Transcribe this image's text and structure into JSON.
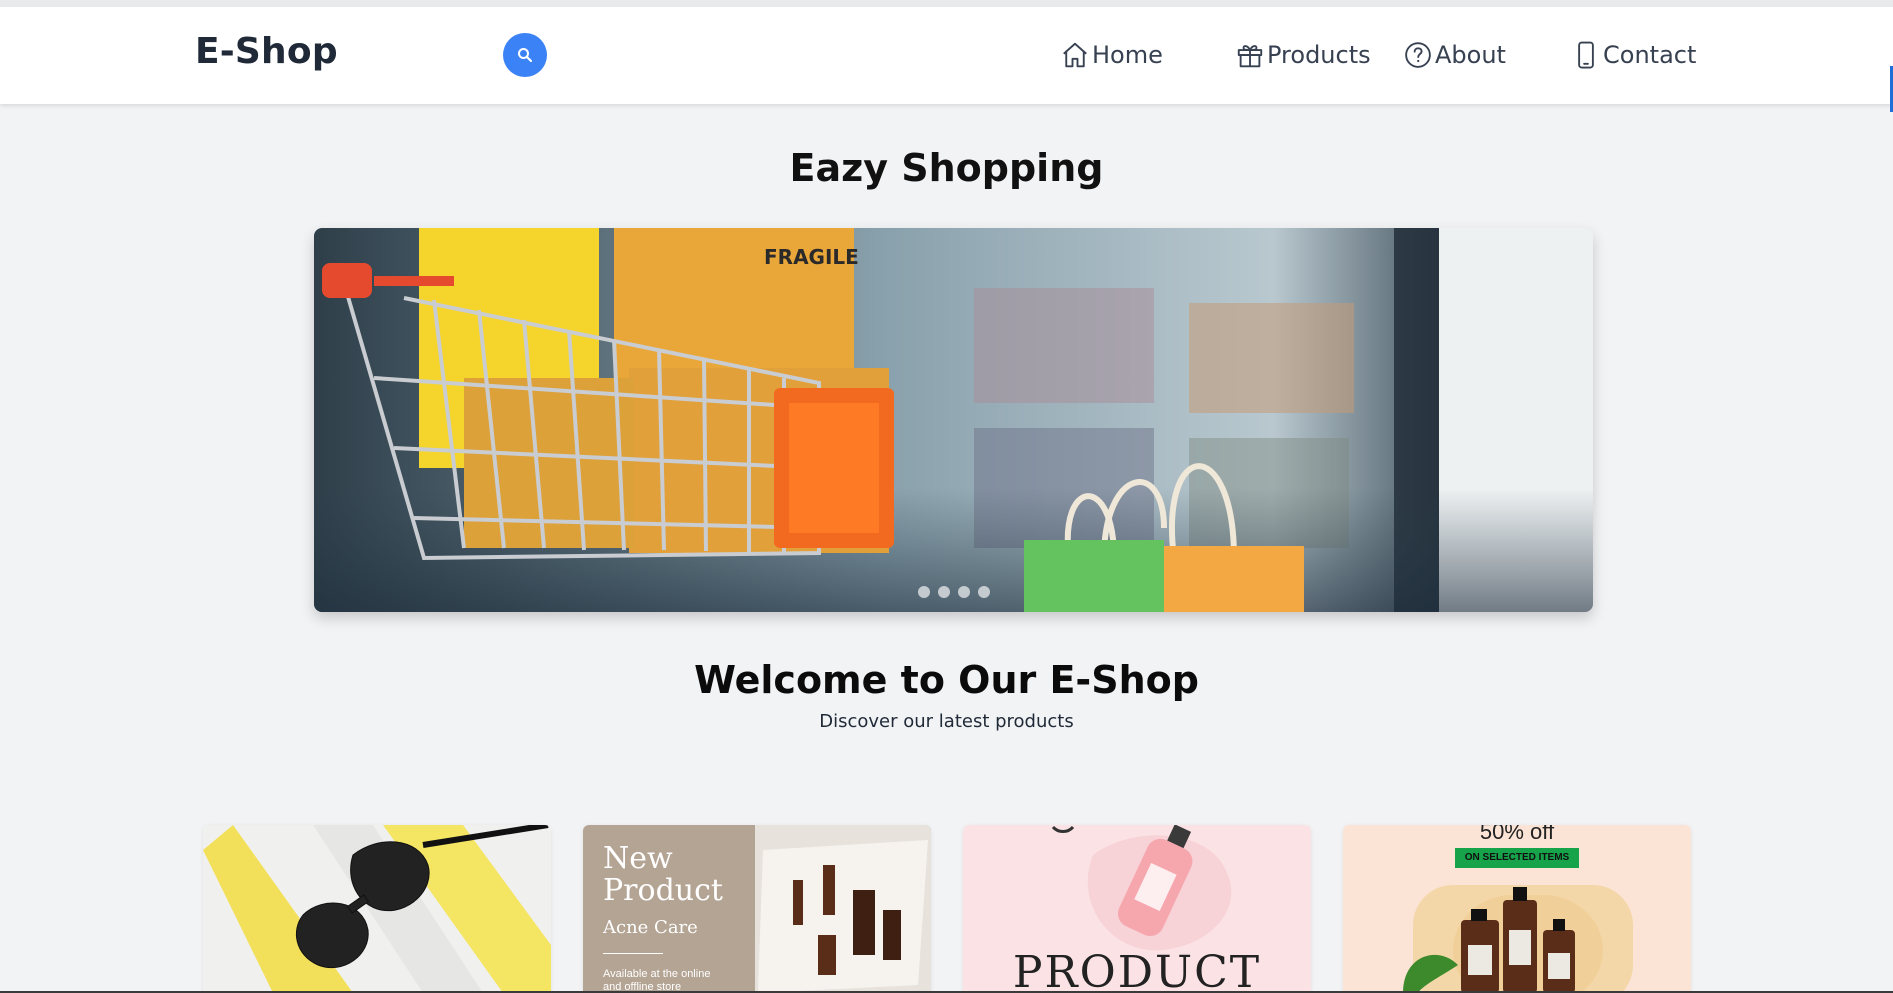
{
  "navbar": {
    "brand": "E-Shop",
    "search_icon": "search-icon",
    "items": [
      {
        "label": "Home",
        "icon": "home-icon"
      },
      {
        "label": "Products",
        "icon": "gift-icon"
      },
      {
        "label": "About",
        "icon": "question-circle-icon"
      },
      {
        "label": "Contact",
        "icon": "phone-icon"
      }
    ]
  },
  "hero": {
    "title": "Eazy Shopping",
    "slide_box_label": "FRAGILE",
    "slide_count": 4,
    "active_slide": 1
  },
  "welcome": {
    "title": "Welcome to Our E-Shop",
    "subtitle": "Discover our latest products"
  },
  "products": [
    {
      "image": "sunglasses-product-image"
    },
    {
      "image": "acne-care-product-image",
      "headline": "New",
      "headline2": "Product",
      "tagline": "Acne Care",
      "note": "Available at the online",
      "note2": "and offline store"
    },
    {
      "image": "pink-bottle-product-image",
      "headline": "PRODUCT"
    },
    {
      "image": "skincare-sale-product-image",
      "promo": "50% off",
      "badge": "ON SELECTED ITEMS"
    }
  ],
  "colors": {
    "accent": "#3b82f6",
    "page_bg": "#f2f3f5",
    "badge_green": "#16a34a"
  }
}
